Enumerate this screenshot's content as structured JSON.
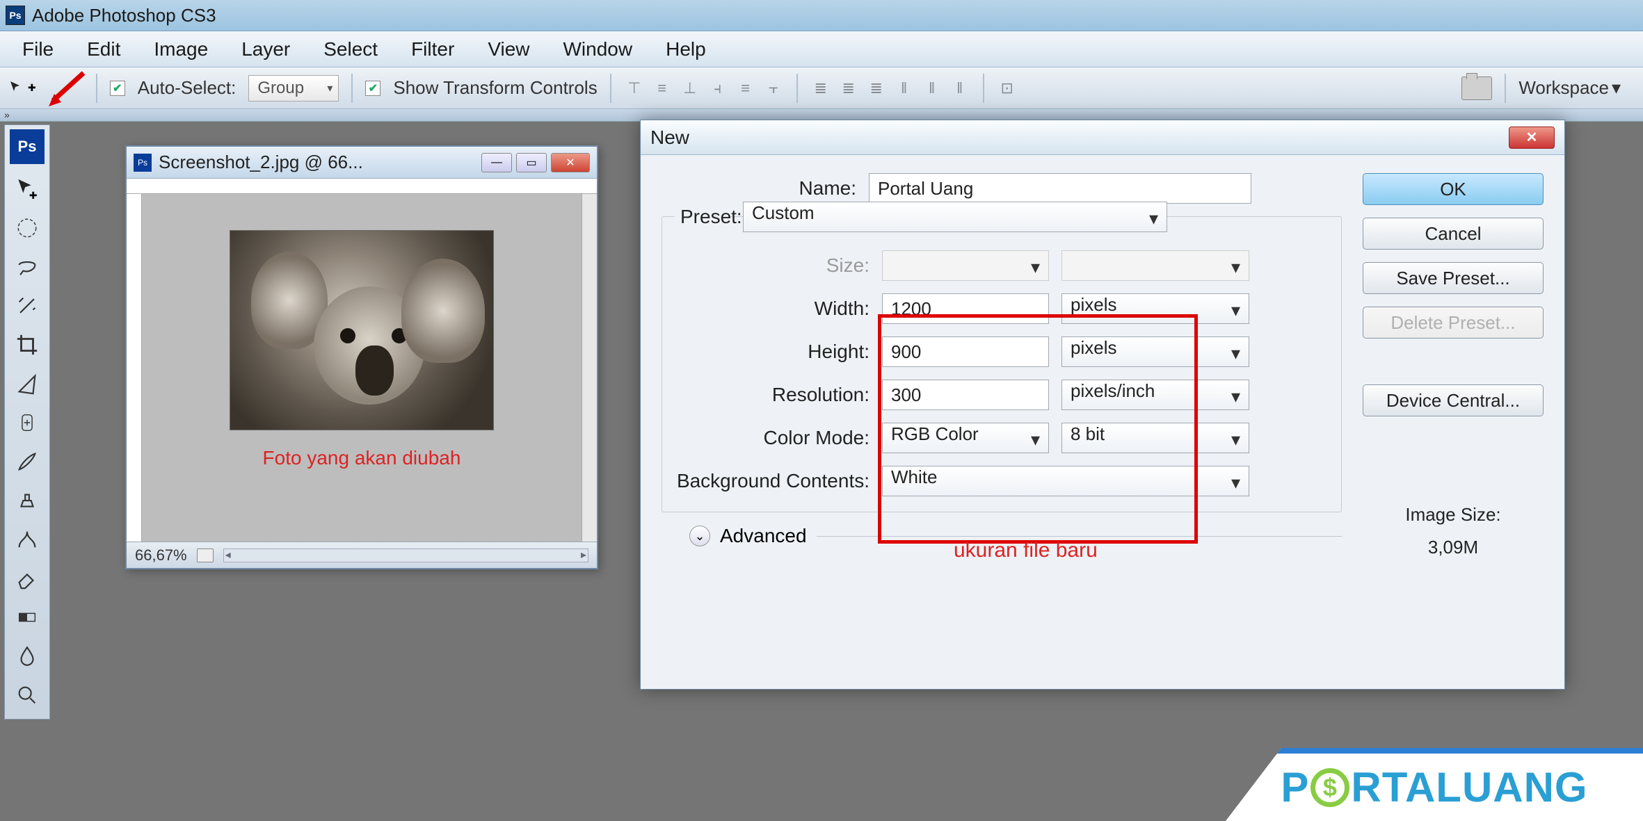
{
  "app": {
    "title": "Adobe Photoshop CS3",
    "icon_label": "Ps"
  },
  "menu": [
    "File",
    "Edit",
    "Image",
    "Layer",
    "Select",
    "Filter",
    "View",
    "Window",
    "Help"
  ],
  "options": {
    "auto_select": "Auto-Select:",
    "auto_select_value": "Group",
    "show_transform": "Show Transform Controls",
    "workspace_label": "Workspace"
  },
  "toolbox": {
    "badge": "Ps"
  },
  "document": {
    "title": "Screenshot_2.jpg @ 66...",
    "zoom": "66,67%",
    "annotation": "Foto yang akan diubah"
  },
  "dialog": {
    "title": "New",
    "name_label": "Name:",
    "name_value": "Portal Uang",
    "preset_label": "Preset:",
    "preset_value": "Custom",
    "size_label": "Size:",
    "width_label": "Width:",
    "width_value": "1200",
    "width_unit": "pixels",
    "height_label": "Height:",
    "height_value": "900",
    "height_unit": "pixels",
    "resolution_label": "Resolution:",
    "resolution_value": "300",
    "resolution_unit": "pixels/inch",
    "color_mode_label": "Color Mode:",
    "color_mode_value": "RGB Color",
    "color_depth": "8 bit",
    "bg_label": "Background Contents:",
    "bg_value": "White",
    "advanced": "Advanced",
    "annotation": "ukuran file baru",
    "buttons": {
      "ok": "OK",
      "cancel": "Cancel",
      "save_preset": "Save Preset...",
      "delete_preset": "Delete Preset...",
      "device_central": "Device Central..."
    },
    "image_size_label": "Image Size:",
    "image_size_value": "3,09M"
  },
  "watermark": {
    "p": "P",
    "dollar": "$",
    "rtal": "RTAL",
    "uang": "UANG"
  }
}
